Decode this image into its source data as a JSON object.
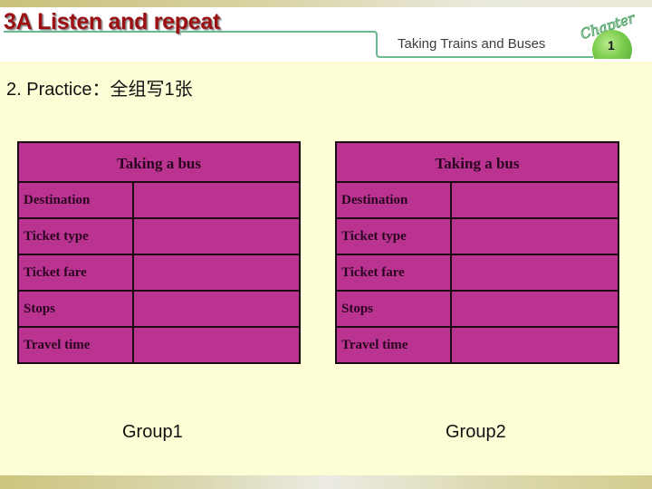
{
  "header": {
    "title": "3A Listen and repeat",
    "chapter_subtitle": "Taking Trains and Buses",
    "chapter_word": "Chapter",
    "chapter_number": "1"
  },
  "instruction": "2. Practice：全组写1张",
  "tables": [
    {
      "title": "Taking a bus",
      "rows": [
        {
          "label": "Destination",
          "value": ""
        },
        {
          "label": "Ticket type",
          "value": ""
        },
        {
          "label": "Ticket fare",
          "value": ""
        },
        {
          "label": "Stops",
          "value": ""
        },
        {
          "label": "Travel time",
          "value": ""
        }
      ],
      "group": "Group1"
    },
    {
      "title": "Taking a bus",
      "rows": [
        {
          "label": "Destination",
          "value": ""
        },
        {
          "label": "Ticket type",
          "value": ""
        },
        {
          "label": "Ticket fare",
          "value": ""
        },
        {
          "label": "Stops",
          "value": ""
        },
        {
          "label": "Travel time",
          "value": ""
        }
      ],
      "group": "Group2"
    }
  ],
  "colors": {
    "title_red": "#9c0f12",
    "table_fill": "#bb3390",
    "background": "#fefed6",
    "accent_green": "#5aa870"
  }
}
